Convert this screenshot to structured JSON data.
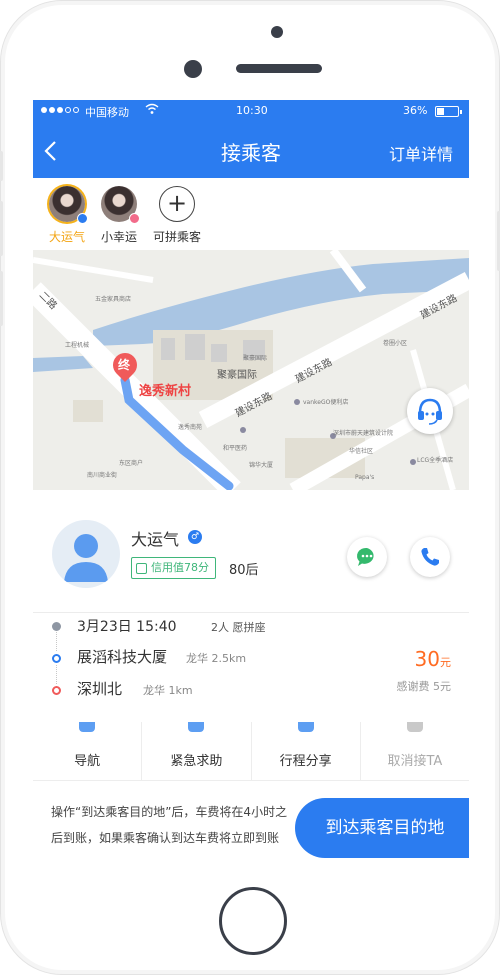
{
  "status_bar": {
    "carrier": "中国移动",
    "time": "10:30",
    "battery_percent": "36%",
    "battery_level": 0.36
  },
  "header": {
    "title": "接乘客",
    "right_link": "订单详情"
  },
  "passengers": [
    {
      "name": "大运气",
      "selected": true,
      "tag_color": "#2b7cf0"
    },
    {
      "name": "小幸运",
      "selected": false,
      "tag_color": "#f26b8a"
    }
  ],
  "add_passenger_label": "可拼乘客",
  "map": {
    "destination": "逸秀新村",
    "pin_label": "终",
    "labels": {
      "road_east_1": "建设东路",
      "road_east_2": "建设东路",
      "road_east_3": "建设东路",
      "road_2": "二路",
      "building": "聚豪国际"
    },
    "pois": [
      "五金家具商店",
      "工程机械",
      "聚豪国际",
      "逸秀南苑",
      "vankeGO便利店",
      "卷圈小区",
      "深圳市蔚天建筑设计院",
      "华信社区",
      "LCG全季酒店",
      "Papa's",
      "和平医药",
      "东区商户",
      "锦华大厦",
      "南川商业街"
    ]
  },
  "passenger_card": {
    "name": "大运气",
    "credit": "信用值78分",
    "age_group": "80后"
  },
  "trip": {
    "datetime": "3月23日 15:40",
    "seats": "2人 愿拼座",
    "from": "展滔科技大厦",
    "from_meta": "龙华 2.5km",
    "to": "深圳北",
    "to_meta": "龙华 1km",
    "fare_amount": "30",
    "fare_unit": "元",
    "tip": "感谢费 5元"
  },
  "actions": [
    {
      "label": "导航",
      "enabled": true
    },
    {
      "label": "紧急求助",
      "enabled": true
    },
    {
      "label": "行程分享",
      "enabled": true
    },
    {
      "label": "取消接TA",
      "enabled": false
    }
  ],
  "notice": "操作“到达乘客目的地”后，车费将在4小时之后到账，如果乘客确认到达车费将立即到账",
  "primary_button": "到达乘客目的地",
  "colors": {
    "brand_blue": "#2b7cf0",
    "fare_orange": "#ff6b22",
    "credit_green": "#3fb67a",
    "highlight_yellow": "#f3a515"
  }
}
